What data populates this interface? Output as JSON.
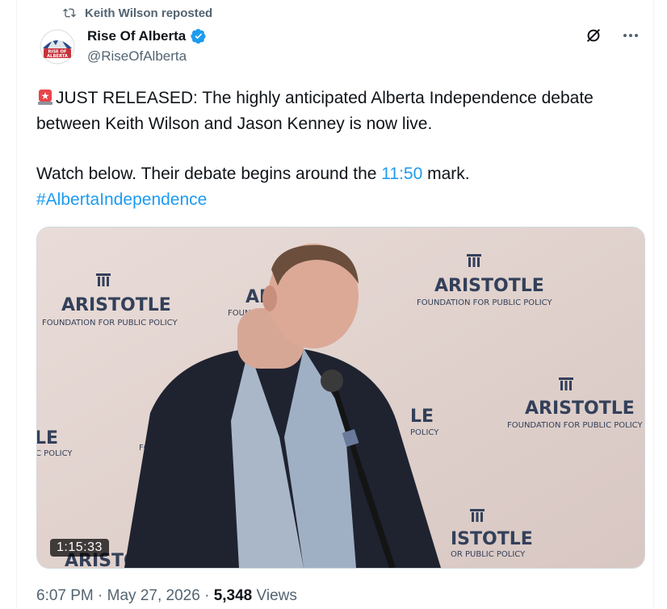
{
  "repost": {
    "label": "Keith Wilson reposted",
    "icon": "repost-icon"
  },
  "author": {
    "name": "Rise Of Alberta",
    "handle": "@RiseOfAlberta",
    "verified": true,
    "avatar_text": "RISE OF ALBERTA"
  },
  "tweet": {
    "line1": "JUST RELEASED: The highly anticipated Alberta Independence debate between Keith Wilson and Jason Kenney is now live.",
    "line2_pre": "Watch below. Their debate begins around the ",
    "timestamp_link": "11:50",
    "line2_post": " mark.",
    "hashtag": "#AlbertaIndependence"
  },
  "video": {
    "duration": "1:15:33",
    "banner_title": "ARISTOTLE",
    "banner_sub": "FOUNDATION FOR PUBLIC POLICY",
    "banner_fragments": [
      "AR",
      "FOUNDATI",
      "LE",
      "C POLICY",
      "LE",
      "POLICY",
      "FO",
      "ARISTOTL",
      "ISTOTLE",
      "OR PUBLIC POLICY"
    ]
  },
  "meta": {
    "time": "6:07 PM",
    "date": "May 27, 2026",
    "separator": "·",
    "views_count": "5,348",
    "views_label": "Views"
  },
  "colors": {
    "accent": "#1d9bf0",
    "secondary": "#536471",
    "text": "#0f1419",
    "siren": "#e8444a"
  }
}
